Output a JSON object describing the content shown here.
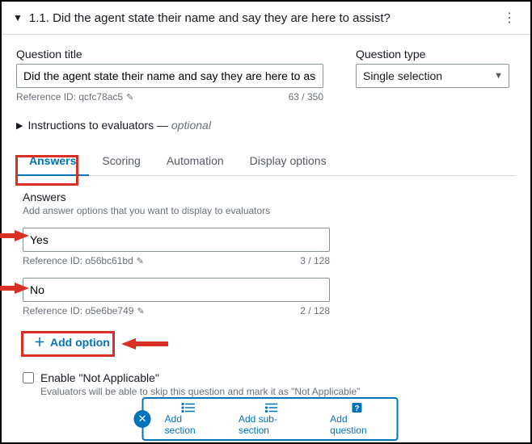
{
  "header": {
    "number": "1.1.",
    "title": "Did the agent state their name and say they are here to assist?"
  },
  "question": {
    "title_label": "Question title",
    "title_value": "Did the agent state their name and say they are here to assist?",
    "ref_label": "Reference ID: qcfc78ac5",
    "counter": "63 / 350",
    "type_label": "Question type",
    "type_value": "Single selection"
  },
  "instructions": {
    "label_prefix": "Instructions to evaluators — ",
    "label_suffix": "optional"
  },
  "tabs": {
    "answers": "Answers",
    "scoring": "Scoring",
    "automation": "Automation",
    "display": "Display options"
  },
  "answers": {
    "heading": "Answers",
    "subheading": "Add answer options that you want to display to evaluators",
    "options": [
      {
        "value": "Yes",
        "ref": "Reference ID: o56bc61bd",
        "counter": "3 / 128"
      },
      {
        "value": "No",
        "ref": "Reference ID: o5e6be749",
        "counter": "2 / 128"
      }
    ],
    "add_label": "Add option"
  },
  "enable_na": {
    "label": "Enable \"Not Applicable\"",
    "sub": "Evaluators will be able to skip this question and mark it as \"Not Applicable\""
  },
  "bottom": {
    "add_section": "Add section",
    "add_sub": "Add sub-section",
    "add_question": "Add question"
  }
}
